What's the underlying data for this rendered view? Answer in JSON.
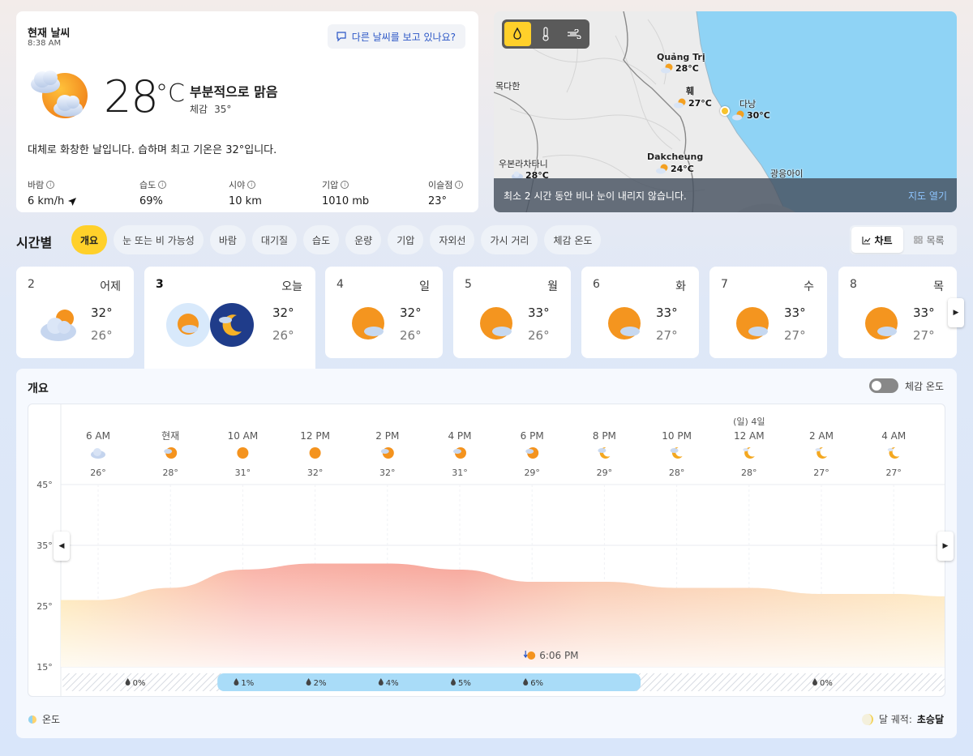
{
  "current": {
    "title": "현재 날씨",
    "time": "8:38 AM",
    "ask_label": "다른 날씨를 보고 있나요?",
    "temp": "28",
    "unit": "°C",
    "condition": "부분적으로 맑음",
    "feels_label": "체감",
    "feels_value": "35°",
    "summary": "대체로 화창한 날입니다. 습하며 최고 기온은 32°입니다.",
    "metrics": [
      {
        "label": "바람",
        "value": "6 km/h"
      },
      {
        "label": "습도",
        "value": "69%"
      },
      {
        "label": "시야",
        "value": "10 km"
      },
      {
        "label": "기압",
        "value": "1010 mb"
      },
      {
        "label": "이슬점",
        "value": "23°"
      }
    ]
  },
  "map": {
    "labels": [
      "목다한",
      "우본라차타니",
      "광응아이"
    ],
    "cities": [
      {
        "name": "Quảng Trị",
        "temp": "28°C"
      },
      {
        "name": "훼",
        "temp": "27°C"
      },
      {
        "name": "다낭",
        "temp": "30°C"
      },
      {
        "name": "Dakcheung",
        "temp": "24°C"
      },
      {
        "name": "",
        "temp": "28°C"
      }
    ],
    "message": "최소 2 시간 동안 비나 눈이 내리지 않습니다.",
    "open_label": "지도 열기"
  },
  "hourly": {
    "title": "시간별",
    "pills": [
      "개요",
      "눈 또는 비 가능성",
      "바람",
      "대기질",
      "습도",
      "운량",
      "기압",
      "자외선",
      "가시 거리",
      "체감 온도"
    ],
    "view_chart": "차트",
    "view_list": "목록"
  },
  "days": [
    {
      "num": "2",
      "name": "어제",
      "hi": "32°",
      "lo": "26°"
    },
    {
      "num": "3",
      "name": "오늘",
      "hi": "32°",
      "lo": "26°"
    },
    {
      "num": "4",
      "name": "일",
      "hi": "32°",
      "lo": "26°"
    },
    {
      "num": "5",
      "name": "월",
      "hi": "33°",
      "lo": "26°"
    },
    {
      "num": "6",
      "name": "화",
      "hi": "33°",
      "lo": "27°"
    },
    {
      "num": "7",
      "name": "수",
      "hi": "33°",
      "lo": "27°"
    },
    {
      "num": "8",
      "name": "목",
      "hi": "33°",
      "lo": "27°"
    }
  ],
  "overview": {
    "title": "개요",
    "feels_toggle": "체감 온도",
    "legend_temp": "온도",
    "moon_label": "달 궤적:",
    "moon_value": "초승달",
    "sunset": "6:06 PM"
  },
  "chart_data": {
    "type": "area",
    "hours": [
      "6 AM",
      "현재",
      "10 AM",
      "12 PM",
      "2 PM",
      "4 PM",
      "6 PM",
      "8 PM",
      "10 PM",
      "12 AM",
      "2 AM",
      "4 AM"
    ],
    "day_marker": "(일) 4일",
    "day_marker_index": 9,
    "temps": [
      26,
      28,
      31,
      32,
      32,
      31,
      29,
      29,
      28,
      28,
      27,
      27
    ],
    "temp_labels": [
      "26°",
      "28°",
      "31°",
      "32°",
      "32°",
      "31°",
      "29°",
      "29°",
      "28°",
      "28°",
      "27°",
      "27°"
    ],
    "icons": [
      "cloudy",
      "partly-sunny",
      "sunny",
      "sunny",
      "partly-sunny",
      "partly-sunny",
      "partly-sunny",
      "partly-moon",
      "partly-moon",
      "moon",
      "moon",
      "moon"
    ],
    "y_ticks": [
      "45°",
      "35°",
      "25°",
      "15°"
    ],
    "ylim": [
      15,
      45
    ],
    "precip": [
      {
        "label": "0%",
        "value": 0
      },
      {
        "label": "1%",
        "value": 1
      },
      {
        "label": "2%",
        "value": 2
      },
      {
        "label": "4%",
        "value": 4
      },
      {
        "label": "5%",
        "value": 5
      },
      {
        "label": "6%",
        "value": 6
      },
      {
        "label": "0%",
        "value": 0
      }
    ]
  }
}
